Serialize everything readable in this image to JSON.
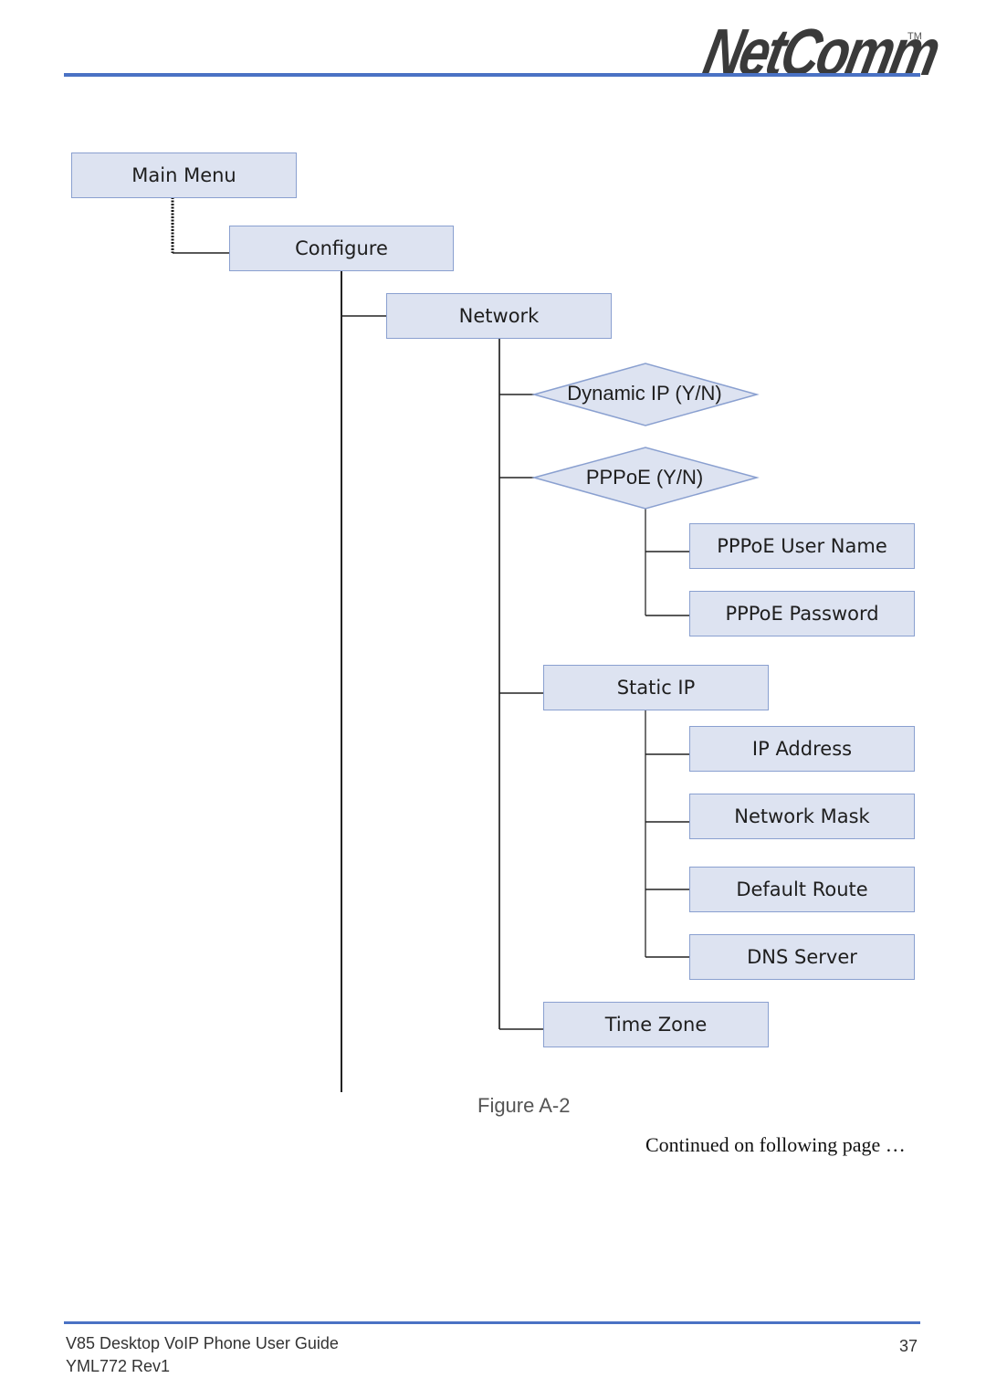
{
  "header": {
    "logo_text": "NetComm",
    "trademark": "TM"
  },
  "diagram": {
    "nodes": {
      "main_menu": "Main Menu",
      "configure": "Configure",
      "network": "Network",
      "dynamic_ip": "Dynamic IP  (Y/N)",
      "pppoe": "PPPoE (Y/N)",
      "pppoe_user_name": "PPPoE User Name",
      "pppoe_password": "PPPoE Password",
      "static_ip": "Static IP",
      "ip_address": "IP Address",
      "network_mask": "Network Mask",
      "default_route": "Default Route",
      "dns_server": "DNS Server",
      "time_zone": "Time Zone"
    }
  },
  "caption": "Figure A-2",
  "continued": "Continued on following page …",
  "footer": {
    "title": "V85 Desktop VoIP Phone User Guide",
    "revision": "YML772 Rev1",
    "page_number": "37"
  }
}
